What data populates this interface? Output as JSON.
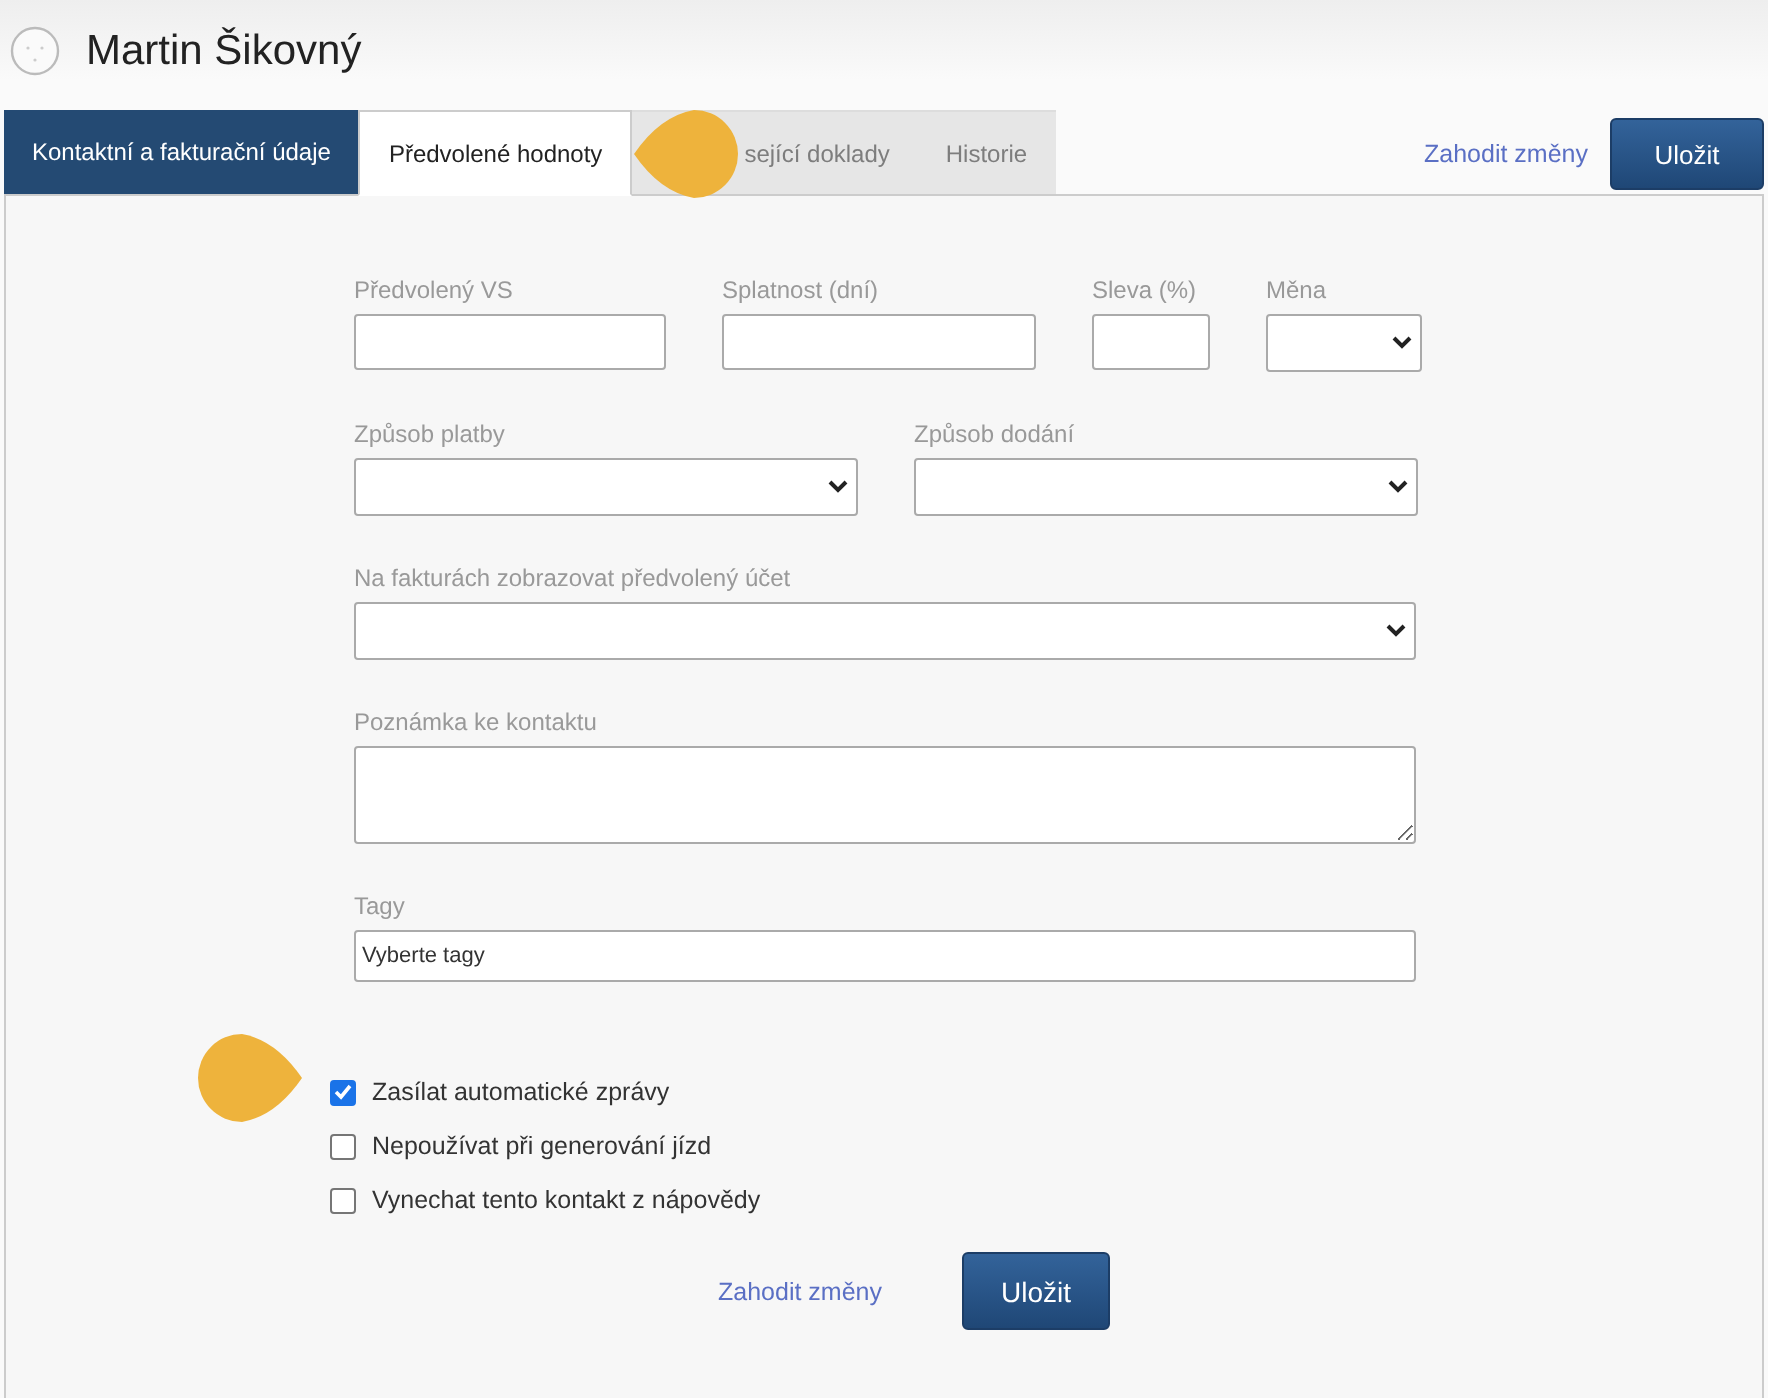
{
  "contact": {
    "name": "Martin Šikovný"
  },
  "tabs": [
    {
      "label": "Kontaktní a fakturační údaje",
      "selected": false,
      "kind": "primary"
    },
    {
      "label": "Předvolené hodnoty",
      "selected": true,
      "kind": "normal"
    },
    {
      "label": "sející doklady",
      "selected": false,
      "kind": "muted"
    },
    {
      "label": "Historie",
      "selected": false,
      "kind": "muted"
    }
  ],
  "top_actions": {
    "discard": "Zahodit změny",
    "save": "Uložit"
  },
  "form_rows": [
    [
      {
        "label": "Předvolený VS",
        "kind": "text"
      },
      {
        "label": "Splatnost (dní)",
        "kind": "text"
      },
      {
        "label": "Sleva (%)",
        "kind": "text"
      },
      {
        "label": "Měna",
        "kind": "select"
      }
    ],
    [
      {
        "label": "Způsob platby",
        "kind": "select"
      },
      {
        "label": "Způsob dodání",
        "kind": "select"
      }
    ],
    [
      {
        "label": "Na fakturách zobrazovat předvolený účet",
        "kind": "select"
      }
    ],
    [
      {
        "label": "Poznámka ke kontaktu",
        "kind": "textarea"
      }
    ],
    [
      {
        "label": "Tagy",
        "kind": "tags",
        "placeholder": "Vyberte tagy"
      }
    ]
  ],
  "options": [
    {
      "label": "Zasílat automatické zprávy",
      "checked": true
    },
    {
      "label": "Nepoužívat při generování jízd",
      "checked": false
    },
    {
      "label": "Vynechat tento kontakt z nápovědy",
      "checked": false
    }
  ],
  "bottom_actions": {
    "discard": "Zahodit změny",
    "save": "Uložit"
  }
}
